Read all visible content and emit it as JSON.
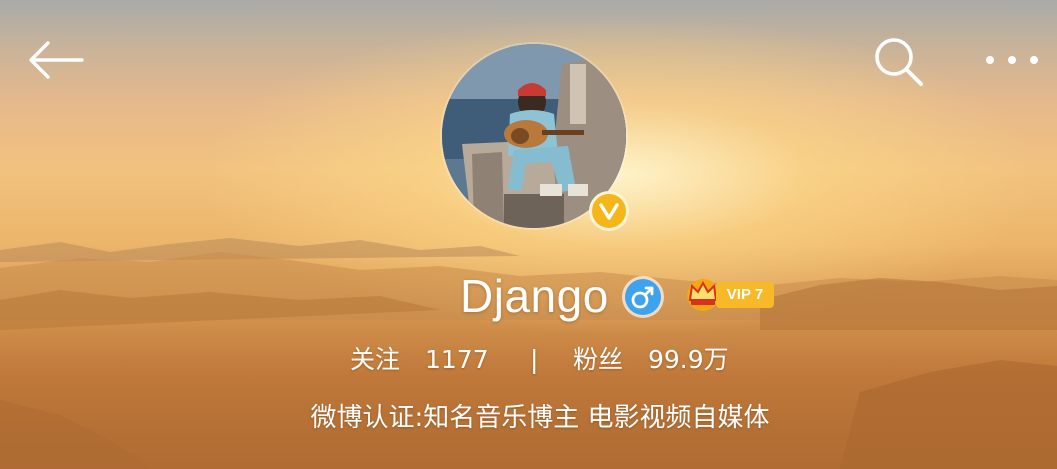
{
  "header": {
    "back_icon": "back-arrow-icon",
    "search_icon": "search-icon",
    "more_icon": "more-dots-icon"
  },
  "profile": {
    "avatar": "avatar-photo",
    "verified_badge": "V",
    "username": "Django",
    "gender_icon": "male-icon",
    "vip_badge": "VIP 7",
    "vip_icon": "crown-icon",
    "following_label": "关注",
    "following_count": "1177",
    "divider": "|",
    "followers_label": "粉丝",
    "followers_count": "99.9万",
    "certification": "微博认证:知名音乐博主 电影视频自媒体"
  },
  "colors": {
    "verified": "#f5b61a",
    "gender": "#3fa2ee",
    "vip": "#f7b928",
    "text": "#ffffff"
  }
}
